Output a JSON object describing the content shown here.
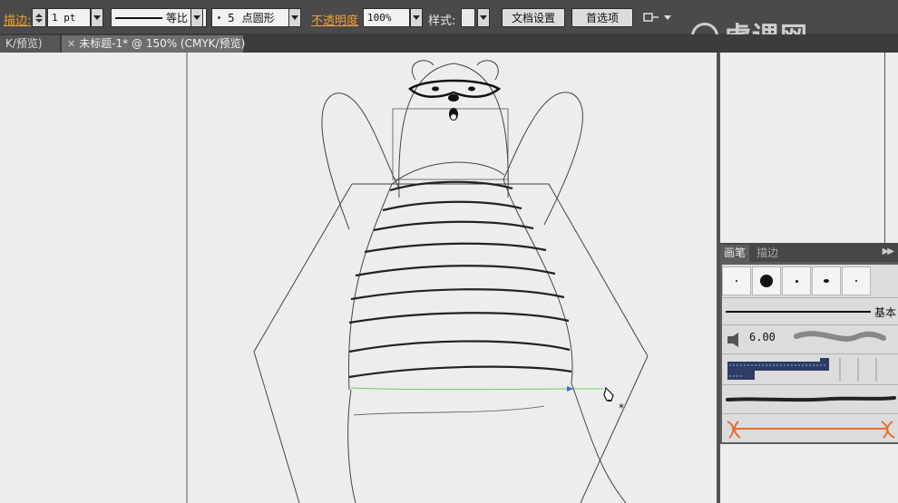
{
  "control_bar": {
    "stroke_label": "描边:",
    "stroke_weight": "1 pt",
    "stroke_profile_label": "等比",
    "brush_definition_size": "5",
    "brush_definition_label": "点圆形",
    "opacity_label": "不透明度",
    "opacity_value": "100%",
    "style_label": "样式:",
    "document_setup_button": "文档设置",
    "preferences_button": "首选项"
  },
  "tabs": [
    {
      "label": "K/预览)",
      "active": false
    },
    {
      "label": "未标题-1* @ 150% (CMYK/预览)",
      "active": true
    }
  ],
  "watermark": "虎课网",
  "brush_panel": {
    "tabs": [
      "画笔",
      "描边"
    ],
    "active_tab": "画笔",
    "basic_brush_label": "基本",
    "size_value": "6.00"
  },
  "colors": {
    "ui_bg": "#535353",
    "canvas": "#ededed",
    "accent_orange": "#f0a030",
    "guide_green": "#5cd65c"
  }
}
